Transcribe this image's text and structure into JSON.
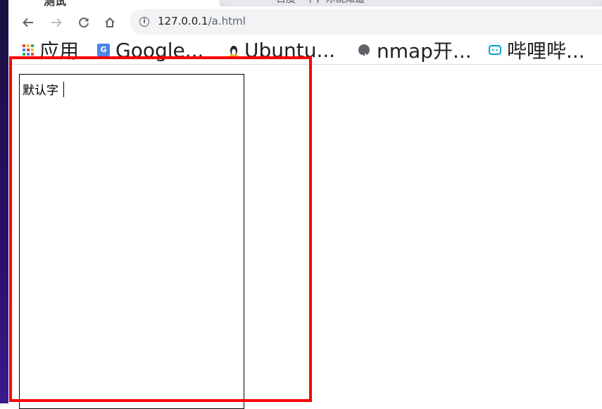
{
  "browser": {
    "active_tab_title": "测试",
    "inactive_tab_title": "百度一下，你就知道",
    "url_host": "127.0.0.1",
    "url_path": "/a.html"
  },
  "nav": {
    "back_icon": "arrow-left-icon",
    "forward_icon": "arrow-right-icon",
    "reload_icon": "reload-icon",
    "home_icon": "home-icon"
  },
  "bookmarks": [
    {
      "label": "应用",
      "icon": "apps-grid-icon"
    },
    {
      "label": "Google...",
      "icon": "google-translate-icon"
    },
    {
      "label": "Ubuntu...",
      "icon": "tux-icon"
    },
    {
      "label": "nmap开...",
      "icon": "globe-icon"
    },
    {
      "label": "哔哩哔...",
      "icon": "bilibili-icon"
    }
  ],
  "page": {
    "textarea_value": "默认字"
  },
  "colors": {
    "highlight": "#ff0000",
    "omnibox_bg": "#f1f3f4",
    "bilibili": "#00a1d6",
    "google": "#4a86e8"
  }
}
